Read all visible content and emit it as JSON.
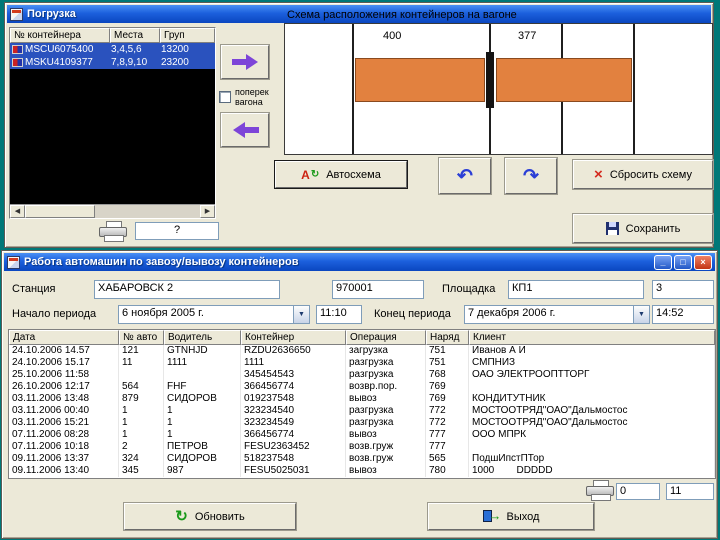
{
  "icons": {
    "dropdown": "▼",
    "undo": "↶",
    "redo": "↷",
    "reset_x": "×",
    "refresh": "↻",
    "exit_arrow": "→",
    "scroll_left": "◀",
    "scroll_right": "▶",
    "minimize": "_",
    "maximize": "□",
    "close": "×",
    "autoscheme_a": "А",
    "autoscheme_arr": "↻"
  },
  "colors": {
    "desktop": "#007878",
    "titlebar_blue": "#1c60dd",
    "container_orange": "#E2813F",
    "selection_blue": "#2A52BE"
  },
  "load_window": {
    "title": "Погрузка",
    "list": {
      "headers": [
        "№ контейнера",
        "Места",
        "Груп"
      ],
      "rows": [
        {
          "container": "MSCU6075400",
          "places": "3,4,5,6",
          "group": "13200"
        },
        {
          "container": "MSKU4109377",
          "places": "7,8,9,10",
          "group": "23200"
        }
      ]
    },
    "across_checkbox_label": "поперек вагона",
    "scheme_label": "Схема расположения контейнеров на вагоне",
    "wagon_numbers": [
      "400",
      "377"
    ],
    "print_value": "?",
    "buttons": {
      "autoscheme": "Автосхема",
      "reset": "Сбросить схему",
      "save": "Сохранить"
    }
  },
  "work_window": {
    "title": "Работа автомашин по завозу/вывозу контейнеров",
    "fields": {
      "station_label": "Станция",
      "station_value": "ХАБАРОВСК  2",
      "station_code": "970001",
      "site_label": "Площадка",
      "site_value": "КП1",
      "site_code": "3",
      "period_start_label": "Начало периода",
      "period_start_date": "6  ноября  2005 г.",
      "period_start_time": "11:10",
      "period_end_label": "Конец периода",
      "period_end_date": "7  декабря  2006 г.",
      "period_end_time": "14:52"
    },
    "table": {
      "headers": [
        "Дата",
        "№ авто",
        "Водитель",
        "Контейнер",
        "Операция",
        "Наряд",
        "Клиент"
      ],
      "rows": [
        [
          "24.10.2006 14.57",
          "121",
          "GTNHJD",
          "RZDU2636650",
          "загрузка",
          "751",
          "Иванов А И"
        ],
        [
          "24.10.2006 15.17",
          "11",
          "1111",
          "1111",
          "разгрузка",
          "751",
          "СМПНИЗ"
        ],
        [
          "25.10.2006 11:58",
          "",
          "",
          "345454543",
          "разгрузка",
          "768",
          "ОАО ЭЛЕКТРООПТТОРГ"
        ],
        [
          "26.10.2006 12:17",
          "564",
          "FHF",
          "366456774",
          "возвр.пор.",
          "769",
          ""
        ],
        [
          "03.11.2006 13:48",
          "879",
          "СИДОРОВ",
          "019237548",
          "вывоз",
          "769",
          "КОНДИТУТНИК"
        ],
        [
          "03.11.2006 00:40",
          "1",
          "1",
          "323234540",
          "разгрузка",
          "772",
          "МОСТООТРЯД\"ОАО\"Дальмостос"
        ],
        [
          "03.11.2006 15:21",
          "1",
          "1",
          "323234549",
          "разгрузка",
          "772",
          "МОСТООТРЯД\"ОАО\"Дальмостос"
        ],
        [
          "07.11.2006 08:28",
          "1",
          "1",
          "366456774",
          "вывоз",
          "777",
          "ООО МПРК"
        ],
        [
          "07.11.2006 10:18",
          "2",
          "ПЕТРОВ",
          "FESU2363452",
          "возв.груж",
          "777",
          ""
        ],
        [
          "09.11.2006 13:37",
          "324",
          "СИДОРОВ",
          "518237548",
          "возв.груж",
          "565",
          "ПодшИпстПТор"
        ],
        [
          "09.11.2006 13:40",
          "345",
          "987",
          "FESU5025031",
          "вывоз",
          "780",
          "1000        DDDDD"
        ]
      ]
    },
    "footer": {
      "count_left": "0",
      "count_right": "11",
      "refresh": "Обновить",
      "exit": "Выход"
    }
  }
}
